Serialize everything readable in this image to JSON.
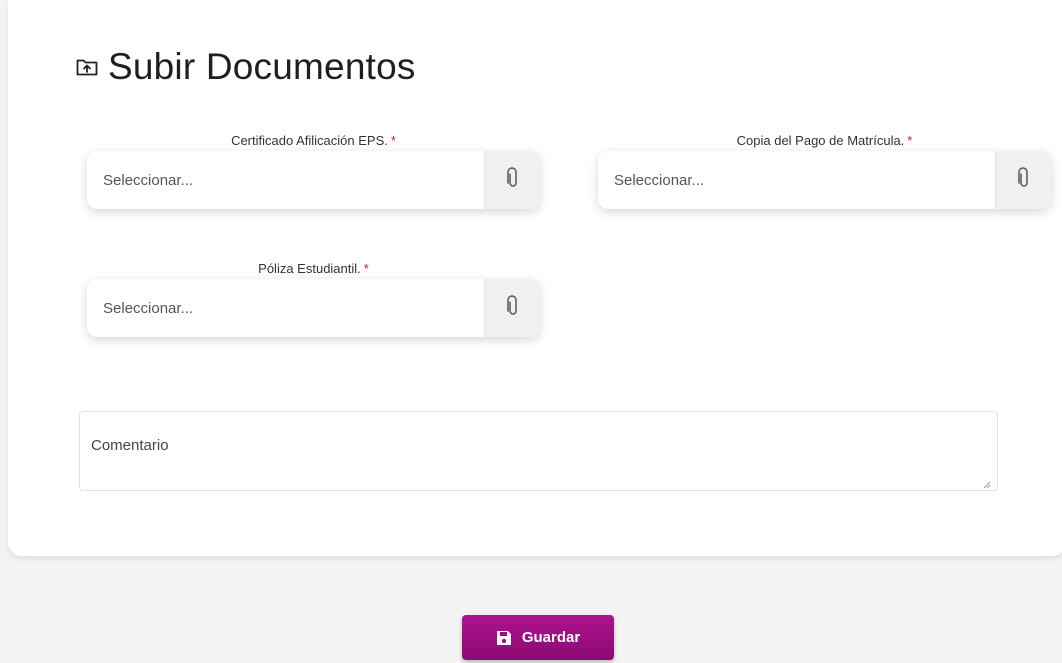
{
  "header": {
    "title": "Subir Documentos",
    "icon": "folder-upload-icon"
  },
  "fields": [
    {
      "label": "Certificado Afilicación EPS.",
      "required_mark": "*",
      "placeholder": "Seleccionar...",
      "icon": "paperclip-icon"
    },
    {
      "label": "Copia del Pago de Matrícula.",
      "required_mark": "*",
      "placeholder": "Seleccionar...",
      "icon": "paperclip-icon"
    },
    {
      "label": "Póliza Estudiantil.",
      "required_mark": "*",
      "placeholder": "Seleccionar...",
      "icon": "paperclip-icon"
    }
  ],
  "comment": {
    "placeholder": "Comentario"
  },
  "actions": {
    "save_label": "Guardar",
    "save_icon": "floppy-disk-icon"
  },
  "colors": {
    "accent": "#9e0e82",
    "required": "#d3123a",
    "background": "#f3f3f3"
  }
}
